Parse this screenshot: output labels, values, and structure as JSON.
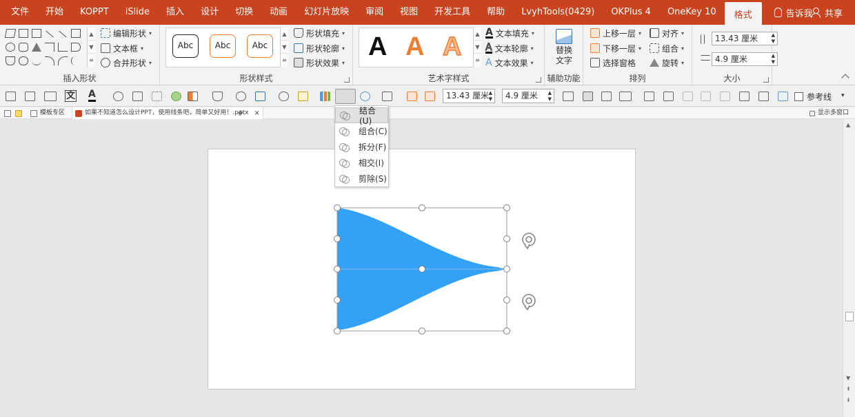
{
  "ribbon_tabs": [
    "文件",
    "开始",
    "KOPPT",
    "iSlide",
    "插入",
    "设计",
    "切换",
    "动画",
    "幻灯片放映",
    "审阅",
    "视图",
    "开发工具",
    "帮助",
    "LvyhTools(0429)",
    "OKPlus 4",
    "OneKey 10",
    "格式"
  ],
  "active_tab": "格式",
  "tell_me": "告诉我",
  "share": "共享",
  "groups": {
    "insert_shapes": {
      "label": "插入形状",
      "edit_shape": "编辑形状",
      "text_box": "文本框",
      "merge_shapes": "合并形状"
    },
    "shape_styles": {
      "label": "形状样式",
      "preset": "Abc",
      "fill": "形状填充",
      "outline": "形状轮廓",
      "effects": "形状效果"
    },
    "wordart_styles": {
      "label": "艺术字样式",
      "preset": "A",
      "text_fill": "文本填充",
      "text_outline": "文本轮廓",
      "text_effects": "文本效果"
    },
    "accessibility": {
      "label": "辅助功能",
      "alt_text_line1": "替换",
      "alt_text_line2": "文字"
    },
    "arrange": {
      "label": "排列",
      "bring_forward": "上移一层",
      "send_backward": "下移一层",
      "selection_pane": "选择窗格",
      "align": "对齐",
      "group": "组合",
      "rotate": "旋转"
    },
    "size": {
      "label": "大小",
      "height": "13.43 厘米",
      "width": "4.9 厘米"
    }
  },
  "quick_toolbar": {
    "text_icon": "文",
    "height": "13.43 厘米",
    "width": "4.9 厘米",
    "guides": "参考线"
  },
  "doc_tabs": {
    "home": "模板专区",
    "file": "如果不知道怎么设计PPT，使用线条吧，简单又好用！.pptx",
    "add": "+",
    "multiwindow": "显示多窗口"
  },
  "merge_menu": [
    {
      "label": "结合(U)",
      "hover": true
    },
    {
      "label": "组合(C)",
      "hover": false
    },
    {
      "label": "拆分(F)",
      "hover": false
    },
    {
      "label": "相交(I)",
      "hover": false
    },
    {
      "label": "剪除(S)",
      "hover": false
    }
  ],
  "colors": {
    "ribbon_red": "#c9431f",
    "shape_fill": "#33a1f5",
    "wordart_orange": "#ed7d31"
  }
}
